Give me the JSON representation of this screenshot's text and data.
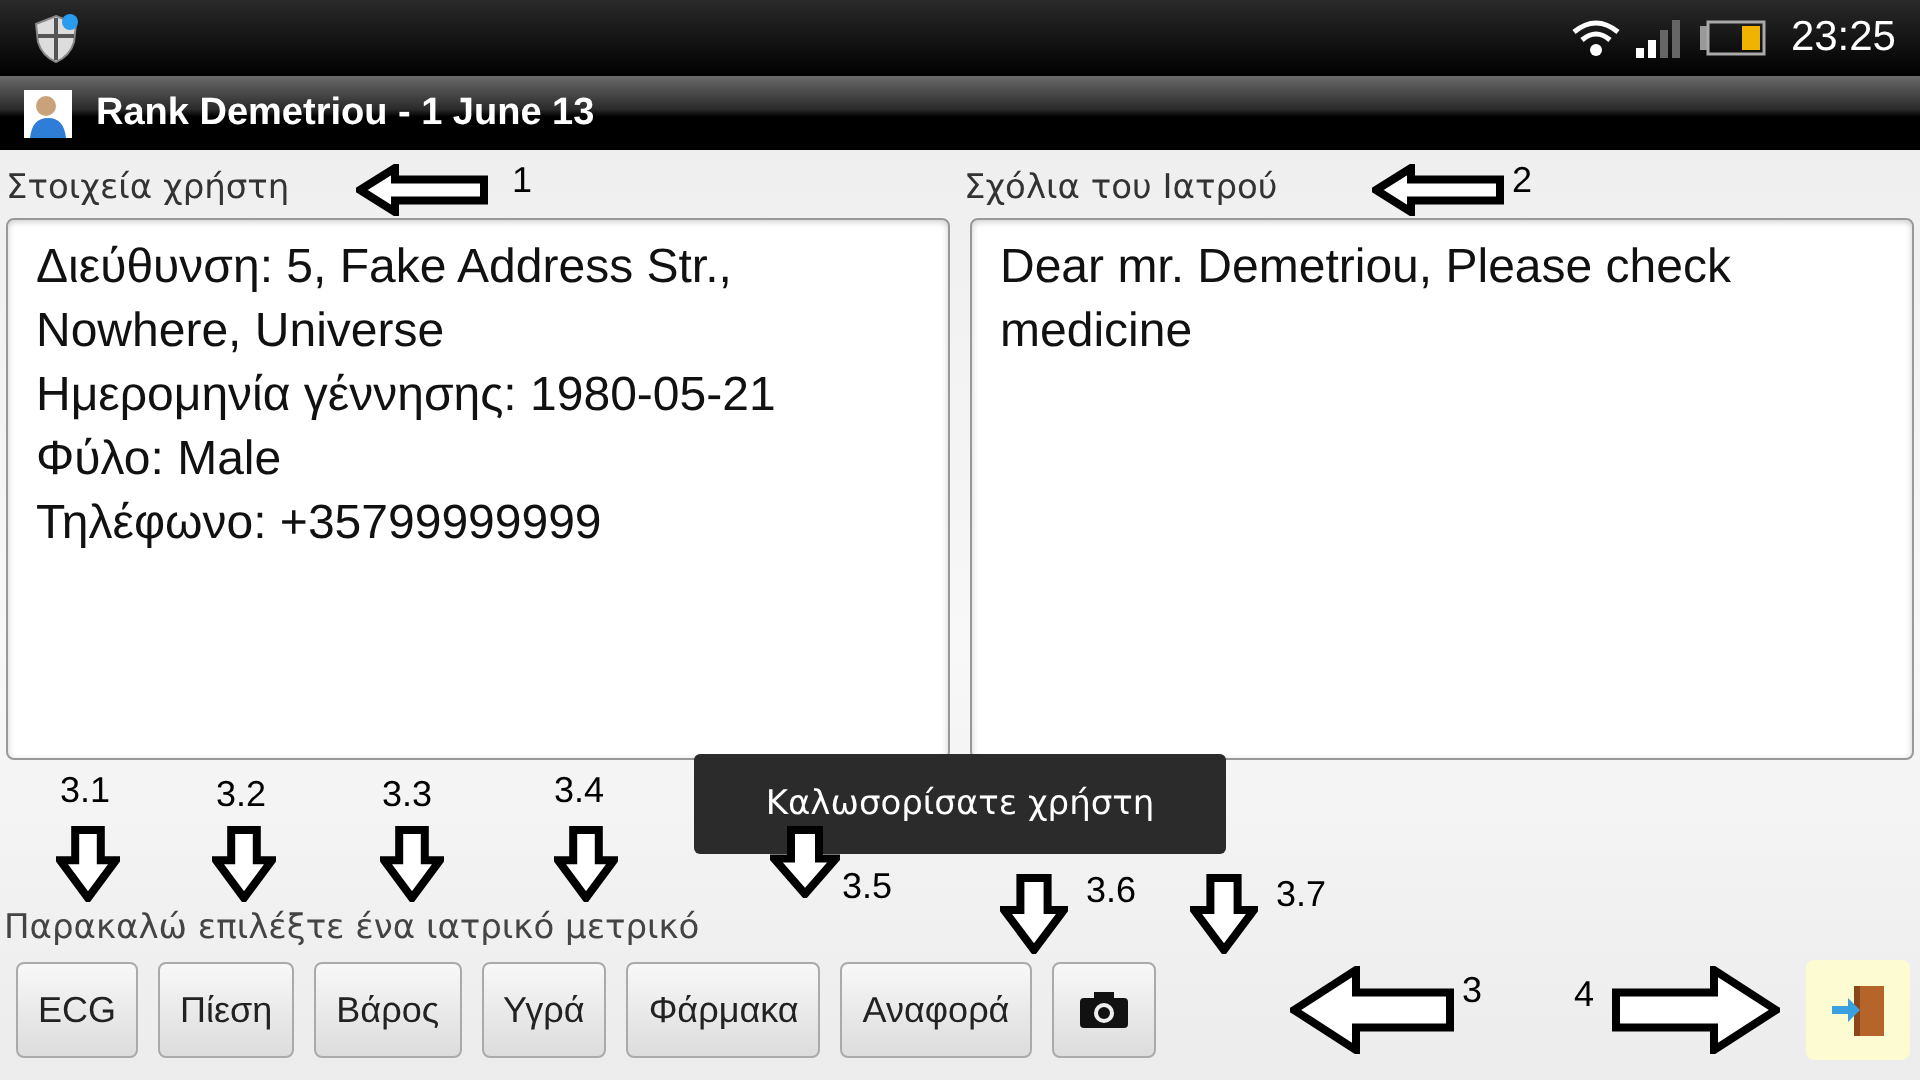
{
  "status_bar": {
    "time": "23:25"
  },
  "title_bar": {
    "title": "Rank Demetriou - 1 June 13"
  },
  "user_info": {
    "label": "Στοιχεία χρήστη",
    "lines": [
      "Διεύθυνση: 5, Fake Address Str., Nowhere, Universe",
      "Ημερομηνία γέννησης: 1980-05-21",
      "Φύλο: Male",
      "Τηλέφωνο: +35799999999"
    ]
  },
  "doctor_notes": {
    "label": "Σχόλια του Ιατρού",
    "text": "Dear mr. Demetriou, Please check medicine"
  },
  "toast": "Καλωσορίσατε χρήστη",
  "prompt": "Παρακαλώ επιλέξτε ένα ιατρικό μετρικό",
  "buttons": [
    {
      "kind": "text",
      "label": "ECG"
    },
    {
      "kind": "text",
      "label": "Πίεση"
    },
    {
      "kind": "text",
      "label": "Βάρος"
    },
    {
      "kind": "text",
      "label": "Υγρά"
    },
    {
      "kind": "text",
      "label": "Φάρμακα"
    },
    {
      "kind": "text",
      "label": "Αναφορά"
    },
    {
      "kind": "camera"
    }
  ],
  "exit_button": {
    "kind": "door"
  },
  "annotations": [
    {
      "label": "1",
      "kind": "left"
    },
    {
      "label": "2",
      "kind": "left"
    },
    {
      "label": "3.1",
      "kind": "down"
    },
    {
      "label": "3.2",
      "kind": "down"
    },
    {
      "label": "3.3",
      "kind": "down"
    },
    {
      "label": "3.4",
      "kind": "down"
    },
    {
      "label": "3.5",
      "kind": "down"
    },
    {
      "label": "3.6",
      "kind": "down"
    },
    {
      "label": "3.7",
      "kind": "down"
    },
    {
      "label": "3",
      "kind": "left"
    },
    {
      "label": "4",
      "kind": "right"
    }
  ]
}
